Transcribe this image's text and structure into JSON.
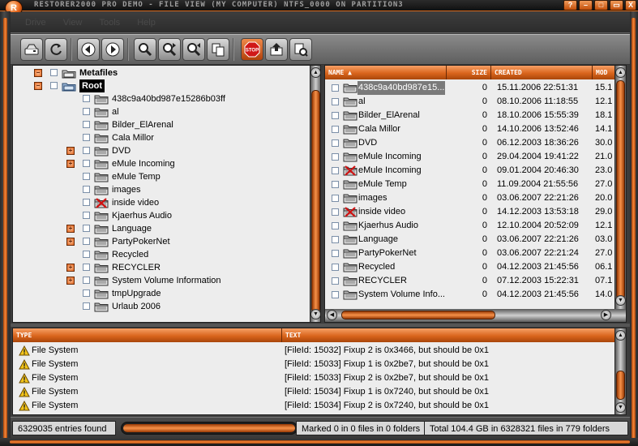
{
  "window": {
    "title": "RESTORER2000 PRO DEMO - FILE VIEW (MY COMPUTER) NTFS_0000 ON PARTITION3",
    "app_icon_glyph": "R",
    "buttons": [
      "?",
      "–",
      "□",
      "▭",
      "X"
    ]
  },
  "menu": {
    "items": [
      "Drive",
      "View",
      "Tools",
      "Help"
    ]
  },
  "toolbar": {
    "icons": [
      "drive-icon",
      "refresh-icon",
      "back-icon",
      "forward-icon",
      "search-icon",
      "search-next-icon",
      "search-prev-icon",
      "copy-icon",
      "stop-icon",
      "export-icon",
      "recover-icon"
    ],
    "stop_label": "STOP"
  },
  "tree": {
    "items": [
      {
        "label": "Metafiles",
        "level": 0,
        "expander": true,
        "icon": "metafiles",
        "bold": true
      },
      {
        "label": "Root",
        "level": 0,
        "expander": true,
        "icon": "root-folder",
        "selected": true
      },
      {
        "label": "438c9a40bd987e15286b03ff",
        "level": 1,
        "expander": false,
        "icon": "folder"
      },
      {
        "label": "al",
        "level": 1,
        "expander": false,
        "icon": "folder"
      },
      {
        "label": "Bilder_ElArenal",
        "level": 1,
        "expander": false,
        "icon": "folder"
      },
      {
        "label": "Cala Millor",
        "level": 1,
        "expander": false,
        "icon": "folder"
      },
      {
        "label": "DVD",
        "level": 1,
        "expander": true,
        "icon": "folder"
      },
      {
        "label": "eMule Incoming",
        "level": 1,
        "expander": true,
        "icon": "folder"
      },
      {
        "label": "eMule Temp",
        "level": 1,
        "expander": false,
        "icon": "folder"
      },
      {
        "label": "images",
        "level": 1,
        "expander": false,
        "icon": "folder"
      },
      {
        "label": "inside video",
        "level": 1,
        "expander": false,
        "icon": "deleted-folder"
      },
      {
        "label": "Kjaerhus Audio",
        "level": 1,
        "expander": false,
        "icon": "folder"
      },
      {
        "label": "Language",
        "level": 1,
        "expander": true,
        "icon": "folder"
      },
      {
        "label": "PartyPokerNet",
        "level": 1,
        "expander": true,
        "icon": "folder"
      },
      {
        "label": "Recycled",
        "level": 1,
        "expander": false,
        "icon": "folder"
      },
      {
        "label": "RECYCLER",
        "level": 1,
        "expander": true,
        "icon": "folder"
      },
      {
        "label": "System Volume Information",
        "level": 1,
        "expander": true,
        "icon": "folder"
      },
      {
        "label": "tmpUpgrade",
        "level": 1,
        "expander": false,
        "icon": "folder"
      },
      {
        "label": "Urlaub 2006",
        "level": 1,
        "expander": false,
        "icon": "folder"
      }
    ]
  },
  "files": {
    "columns": [
      "NAME",
      "SIZE",
      "CREATED",
      "MOD"
    ],
    "sort_arrow": "▲",
    "rows": [
      {
        "name": "438c9a40bd987e15...",
        "size": "0",
        "created": "15.11.2006 22:51:31",
        "mod": "15.1",
        "icon": "folder",
        "selected": true
      },
      {
        "name": "al",
        "size": "0",
        "created": "08.10.2006 11:18:55",
        "mod": "12.1",
        "icon": "folder"
      },
      {
        "name": "Bilder_ElArenal",
        "size": "0",
        "created": "18.10.2006 15:55:39",
        "mod": "18.1",
        "icon": "folder"
      },
      {
        "name": "Cala Millor",
        "size": "0",
        "created": "14.10.2006 13:52:46",
        "mod": "14.1",
        "icon": "folder"
      },
      {
        "name": "DVD",
        "size": "0",
        "created": "06.12.2003 18:36:26",
        "mod": "30.0",
        "icon": "folder"
      },
      {
        "name": "eMule Incoming",
        "size": "0",
        "created": "29.04.2004 19:41:22",
        "mod": "21.0",
        "icon": "folder"
      },
      {
        "name": "eMule Incoming",
        "size": "0",
        "created": "09.01.2004 20:46:30",
        "mod": "23.0",
        "icon": "deleted-folder"
      },
      {
        "name": "eMule Temp",
        "size": "0",
        "created": "11.09.2004 21:55:56",
        "mod": "27.0",
        "icon": "folder"
      },
      {
        "name": "images",
        "size": "0",
        "created": "03.06.2007 22:21:26",
        "mod": "20.0",
        "icon": "folder"
      },
      {
        "name": "inside video",
        "size": "0",
        "created": "14.12.2003 13:53:18",
        "mod": "29.0",
        "icon": "deleted-folder"
      },
      {
        "name": "Kjaerhus Audio",
        "size": "0",
        "created": "12.10.2004 20:52:09",
        "mod": "12.1",
        "icon": "folder"
      },
      {
        "name": "Language",
        "size": "0",
        "created": "03.06.2007 22:21:26",
        "mod": "03.0",
        "icon": "folder"
      },
      {
        "name": "PartyPokerNet",
        "size": "0",
        "created": "03.06.2007 22:21:24",
        "mod": "27.0",
        "icon": "folder"
      },
      {
        "name": "Recycled",
        "size": "0",
        "created": "04.12.2003 21:45:56",
        "mod": "06.1",
        "icon": "folder"
      },
      {
        "name": "RECYCLER",
        "size": "0",
        "created": "07.12.2003 15:22:31",
        "mod": "07.1",
        "icon": "folder"
      },
      {
        "name": "System Volume Info...",
        "size": "0",
        "created": "04.12.2003 21:45:56",
        "mod": "14.0",
        "icon": "folder"
      }
    ]
  },
  "log": {
    "columns": [
      "TYPE",
      "TEXT"
    ],
    "rows": [
      {
        "type": "File System",
        "text": "[FileId: 15032] Fixup 2 is 0x3466, but should be 0x1"
      },
      {
        "type": "File System",
        "text": "[FileId: 15033] Fixup 1 is 0x2be7, but should be 0x1"
      },
      {
        "type": "File System",
        "text": "[FileId: 15033] Fixup 2 is 0x2be7, but should be 0x1"
      },
      {
        "type": "File System",
        "text": "[FileId: 15034] Fixup 1 is 0x7240, but should be 0x1"
      },
      {
        "type": "File System",
        "text": "[FileId: 15034] Fixup 2 is 0x7240, but should be 0x1"
      }
    ]
  },
  "status": {
    "entries": "6329035 entries found",
    "progress": 1.0,
    "marked": "Marked 0 in 0 files in 0 folders",
    "total": "Total 104.4 GB in 6328321 files in 779 folders"
  },
  "colors": {
    "accent": "#e0621a",
    "panel_bg": "#ededed",
    "frame": "#3c3c3c"
  }
}
